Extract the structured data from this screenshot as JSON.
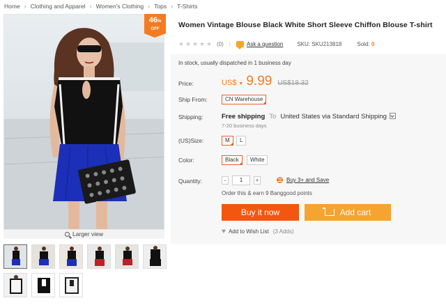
{
  "breadcrumb": [
    "Home",
    "Clothing and Apparel",
    "Women's Clothing",
    "Tops",
    "T-Shirts"
  ],
  "badge": {
    "percent": "46",
    "percent_sign": "%",
    "label": "OFF"
  },
  "gallery": {
    "larger_view": "Larger view",
    "thumb_count": 9,
    "active_thumb": 0
  },
  "product": {
    "title": "Women Vintage Blouse Black White Short Sleeve Chiffon Blouse T-shirt",
    "rating_stars": 0,
    "reviews": "(0)",
    "ask": "Ask a question",
    "sku": "SKU: SKU213818",
    "sold_label": "Sold:",
    "sold_value": "0",
    "stock": "In stock, usually dispatched in 1 business day"
  },
  "price": {
    "label": "Price:",
    "currency": "US$",
    "now": "9.99",
    "old": "US$18.32"
  },
  "ship_from": {
    "label": "Ship From:",
    "value": "CN Warehouse"
  },
  "shipping": {
    "label": "Shipping:",
    "method": "Free shipping",
    "to": "To",
    "dest": "United States via Standard Shipping",
    "days": "7-20 business days"
  },
  "size": {
    "label": "(US)Size:",
    "options": [
      "M",
      "L"
    ],
    "selected": "M"
  },
  "color": {
    "label": "Color:",
    "options": [
      "Black",
      "White"
    ],
    "selected": "Black"
  },
  "quantity": {
    "label": "Quantity:",
    "minus": "-",
    "value": "1",
    "plus": "+"
  },
  "promo": {
    "buy3": "Buy 3+ and Save",
    "earn": "Order this & earn 9 Banggood points"
  },
  "actions": {
    "buy_now": "Buy it now",
    "add_cart": "Add cart",
    "wishlist": "Add to Wish List",
    "wish_count": "(3 Adds)"
  },
  "colors": {
    "accent": "#f57b20",
    "buy": "#f3560d",
    "cart": "#f7a330",
    "selected_border": "#f05a28"
  }
}
